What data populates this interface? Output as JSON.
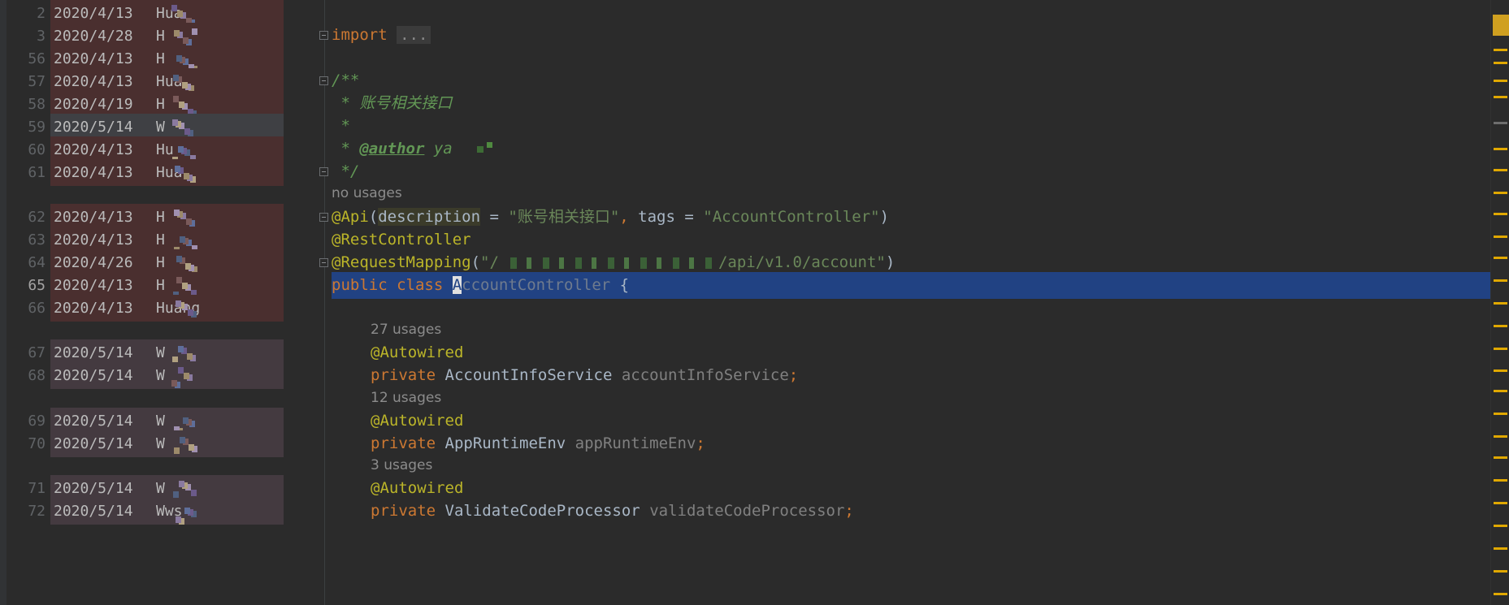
{
  "blame": [
    {
      "line": "2",
      "date": "2020/4/13",
      "author": "Hua",
      "tint": "red"
    },
    {
      "line": "3",
      "date": "2020/4/28",
      "author": "H",
      "tint": "red"
    },
    {
      "line": "56",
      "date": "2020/4/13",
      "author": "H",
      "tint": "red"
    },
    {
      "line": "57",
      "date": "2020/4/13",
      "author": "Hua",
      "tint": "red"
    },
    {
      "line": "58",
      "date": "2020/4/19",
      "author": "H",
      "tint": "red"
    },
    {
      "line": "59",
      "date": "2020/5/14",
      "author": "W",
      "tint": "grey"
    },
    {
      "line": "60",
      "date": "2020/4/13",
      "author": "Hu",
      "tint": "red"
    },
    {
      "line": "61",
      "date": "2020/4/13",
      "author": "Hua",
      "tint": "red"
    },
    {
      "line": "",
      "date": "",
      "author": "",
      "tint": "none"
    },
    {
      "line": "62",
      "date": "2020/4/13",
      "author": "H",
      "tint": "red"
    },
    {
      "line": "63",
      "date": "2020/4/13",
      "author": "H",
      "tint": "red"
    },
    {
      "line": "64",
      "date": "2020/4/26",
      "author": "H",
      "tint": "red"
    },
    {
      "line": "65",
      "date": "2020/4/13",
      "author": "H",
      "tint": "red",
      "current": true
    },
    {
      "line": "66",
      "date": "2020/4/13",
      "author": "Huang",
      "tint": "red"
    },
    {
      "line": "",
      "date": "",
      "author": "",
      "tint": "none"
    },
    {
      "line": "67",
      "date": "2020/5/14",
      "author": "W",
      "tint": "purple"
    },
    {
      "line": "68",
      "date": "2020/5/14",
      "author": "W",
      "tint": "purple"
    },
    {
      "line": "",
      "date": "",
      "author": "",
      "tint": "none"
    },
    {
      "line": "69",
      "date": "2020/5/14",
      "author": "W",
      "tint": "purple"
    },
    {
      "line": "70",
      "date": "2020/5/14",
      "author": "W",
      "tint": "purple"
    },
    {
      "line": "",
      "date": "",
      "author": "",
      "tint": "none"
    },
    {
      "line": "71",
      "date": "2020/5/14",
      "author": "W",
      "tint": "purple"
    },
    {
      "line": "72",
      "date": "2020/5/14",
      "author": "Wws",
      "tint": "purple"
    }
  ],
  "code": {
    "import_kw": "import",
    "import_fold": "...",
    "doc_open": "/**",
    "doc_desc": " * 账号相关接口",
    "doc_blank": " *",
    "doc_author_prefix": " * ",
    "doc_author_tag": "@author",
    "doc_author_name": " ya",
    "doc_close": " */",
    "usages_class": "no usages",
    "api_ann": "@Api",
    "api_open": "(",
    "api_param1": "description",
    "api_eq1": " = ",
    "api_val1": "\"账号相关接口\"",
    "api_comma": ", ",
    "api_param2": "tags",
    "api_eq2": " = ",
    "api_val2": "\"AccountController\"",
    "api_close": ")",
    "rest_ann": "@RestController",
    "req_ann": "@RequestMapping",
    "req_open": "(",
    "req_val_start": "\"/",
    "req_val_end": "/api/v1.0/account\"",
    "req_close": ")",
    "class_kw": "public class ",
    "class_caret_char": "A",
    "class_name_rest": "ccountController",
    "class_brace": " {",
    "usages_1": "27 usages",
    "autowired": "@Autowired",
    "field1_kw": "private ",
    "field1_type": "AccountInfoService ",
    "field1_name": "accountInfoService",
    "semi": ";",
    "usages_2": "12 usages",
    "field2_type": "AppRuntimeEnv ",
    "field2_name": "appRuntimeEnv",
    "usages_3": "3 usages",
    "field3_type": "ValidateCodeProcessor ",
    "field3_name": "validateCodeProcessor"
  },
  "colors": {
    "blame_red": "#4a2f2f",
    "blame_grey": "#3f4044",
    "blame_purple": "#443a40",
    "selection": "#214283",
    "marker": "#e0a800"
  }
}
